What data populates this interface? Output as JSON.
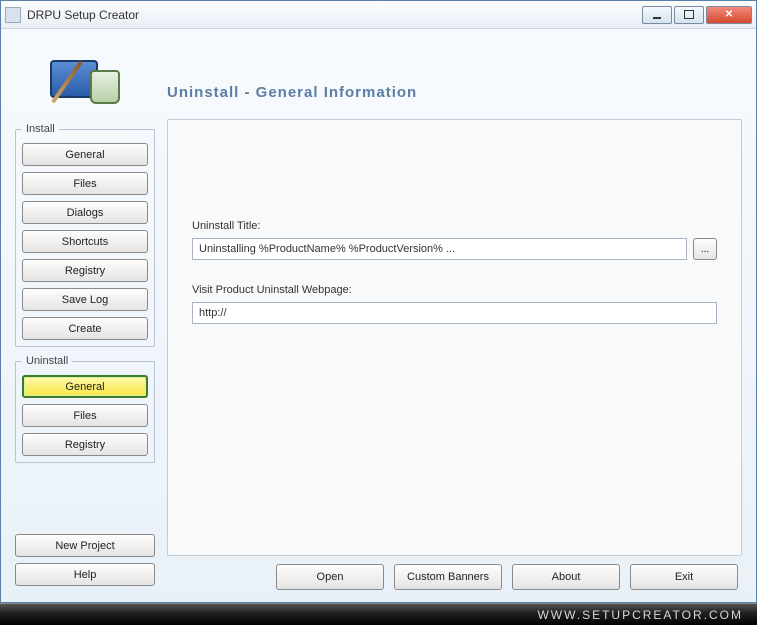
{
  "window": {
    "title": "DRPU Setup Creator"
  },
  "page": {
    "heading": "Uninstall - General Information"
  },
  "sidebar": {
    "install": {
      "legend": "Install",
      "items": [
        {
          "label": "General"
        },
        {
          "label": "Files"
        },
        {
          "label": "Dialogs"
        },
        {
          "label": "Shortcuts"
        },
        {
          "label": "Registry"
        },
        {
          "label": "Save Log"
        },
        {
          "label": "Create"
        }
      ]
    },
    "uninstall": {
      "legend": "Uninstall",
      "items": [
        {
          "label": "General",
          "active": true
        },
        {
          "label": "Files"
        },
        {
          "label": "Registry"
        }
      ]
    },
    "bottom": {
      "new_project": "New Project",
      "help": "Help"
    }
  },
  "form": {
    "uninstall_title_label": "Uninstall Title:",
    "uninstall_title_value": "Uninstalling %ProductName% %ProductVersion% ...",
    "browse_label": "...",
    "webpage_label": "Visit Product Uninstall Webpage:",
    "webpage_value": "http://"
  },
  "actions": {
    "open": "Open",
    "custom_banners": "Custom Banners",
    "about": "About",
    "exit": "Exit"
  },
  "footer": {
    "text": "WWW.SETUPCREATOR.COM"
  }
}
